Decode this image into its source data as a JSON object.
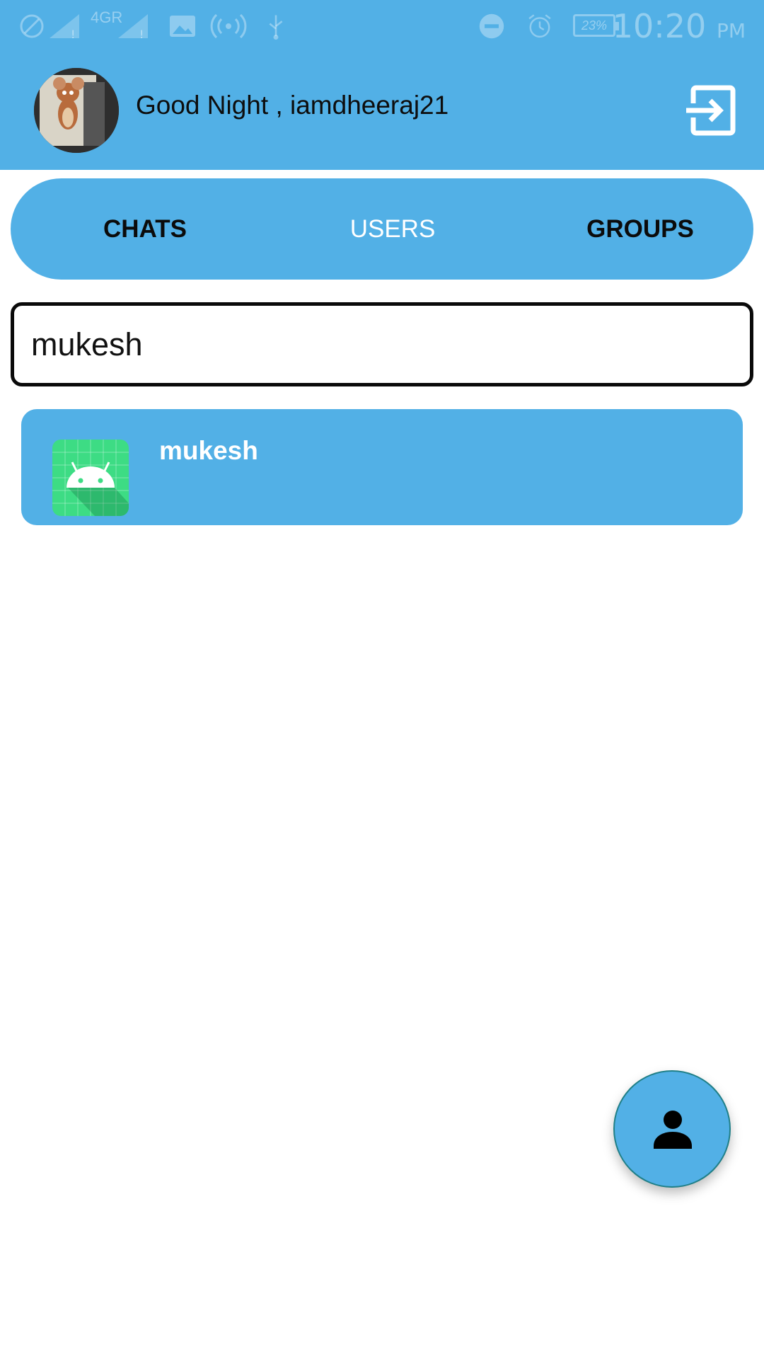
{
  "status_bar": {
    "network_label": "4GR",
    "battery": "23%",
    "time": "10:20",
    "ampm": "PM"
  },
  "header": {
    "greeting": "Good Night , iamdheeraj21",
    "avatar_icon": "user-avatar",
    "logout_icon": "logout-icon"
  },
  "tabs": [
    {
      "label": "CHATS",
      "active": false
    },
    {
      "label": "USERS",
      "active": true
    },
    {
      "label": "GROUPS",
      "active": false
    }
  ],
  "search": {
    "value": "mukesh"
  },
  "results": [
    {
      "name": "mukesh",
      "icon": "android-icon"
    }
  ],
  "fab": {
    "icon": "person-icon"
  },
  "colors": {
    "primary": "#52B0E6",
    "text_dark": "#0b0b0b",
    "android_green": "#3DDC84"
  }
}
